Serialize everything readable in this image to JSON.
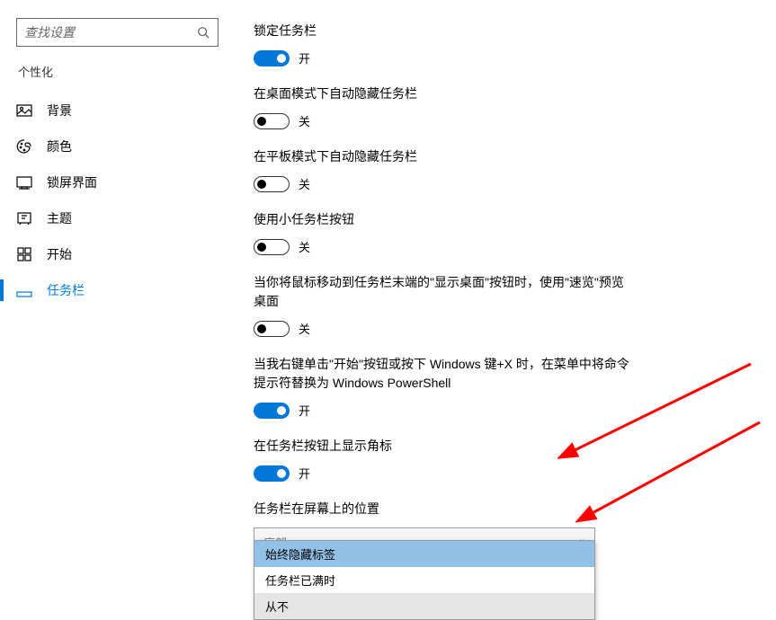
{
  "sidebar": {
    "search_placeholder": "查找设置",
    "section_title": "个性化",
    "items": [
      {
        "label": "背景",
        "icon": "picture"
      },
      {
        "label": "颜色",
        "icon": "palette"
      },
      {
        "label": "锁屏界面",
        "icon": "lockscreen"
      },
      {
        "label": "主题",
        "icon": "theme"
      },
      {
        "label": "开始",
        "icon": "start"
      },
      {
        "label": "任务栏",
        "icon": "taskbar",
        "active": true
      }
    ]
  },
  "settings": [
    {
      "title": "锁定任务栏",
      "state": "on",
      "state_label": "开"
    },
    {
      "title": "在桌面模式下自动隐藏任务栏",
      "state": "off",
      "state_label": "关"
    },
    {
      "title": "在平板模式下自动隐藏任务栏",
      "state": "off",
      "state_label": "关"
    },
    {
      "title": "使用小任务栏按钮",
      "state": "off",
      "state_label": "关"
    },
    {
      "title": "当你将鼠标移动到任务栏末端的\"显示桌面\"按钮时，使用\"速览\"预览桌面",
      "state": "off",
      "state_label": "关"
    },
    {
      "title": "当我右键单击\"开始\"按钮或按下 Windows 键+X 时，在菜单中将命令提示符替换为 Windows PowerShell",
      "state": "on",
      "state_label": "开"
    },
    {
      "title": "在任务栏按钮上显示角标",
      "state": "on",
      "state_label": "开"
    }
  ],
  "dropdown": {
    "title": "任务栏在屏幕上的位置",
    "selected": "底部",
    "options": [
      "始终隐藏标签",
      "任务栏已满时",
      "从不"
    ]
  }
}
